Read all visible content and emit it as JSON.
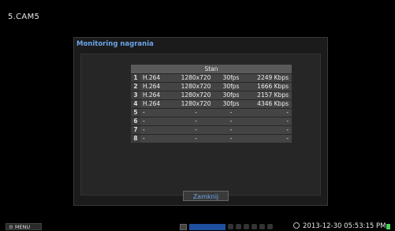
{
  "camera_label": "5.CAM5",
  "dialog": {
    "title": "Monitoring nagrania",
    "table_header": "Stan",
    "rows": [
      {
        "num": "1",
        "codec": "H.264",
        "res": "1280x720",
        "fps": "30fps",
        "rate": "2249 Kbps"
      },
      {
        "num": "2",
        "codec": "H.264",
        "res": "1280x720",
        "fps": "30fps",
        "rate": "1666 Kbps"
      },
      {
        "num": "3",
        "codec": "H.264",
        "res": "1280x720",
        "fps": "30fps",
        "rate": "2157 Kbps"
      },
      {
        "num": "4",
        "codec": "H.264",
        "res": "1280x720",
        "fps": "30fps",
        "rate": "4346 Kbps"
      },
      {
        "num": "5",
        "codec": "-",
        "res": "-",
        "fps": "-",
        "rate": "-"
      },
      {
        "num": "6",
        "codec": "-",
        "res": "-",
        "fps": "-",
        "rate": "-"
      },
      {
        "num": "7",
        "codec": "-",
        "res": "-",
        "fps": "-",
        "rate": "-"
      },
      {
        "num": "8",
        "codec": "-",
        "res": "-",
        "fps": "-",
        "rate": "-"
      }
    ],
    "close_label": "Zamknij"
  },
  "bottom_bar": {
    "menu_label": "MENU",
    "datetime": "2013-12-30 05:53:15 PM"
  },
  "icons": {
    "menu": "gear-icon",
    "clock": "clock-icon",
    "record_status": "record-status-icon"
  },
  "colors": {
    "accent_blue": "#6aa5e8",
    "status_green": "#4bd25b"
  }
}
